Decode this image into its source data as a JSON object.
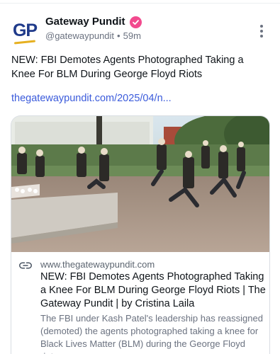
{
  "author": {
    "avatar_text": "GP",
    "name": "Gateway Pundit",
    "handle": "@gatewaypundit",
    "separator": "•",
    "time": "59m"
  },
  "post": {
    "text": "NEW: FBI Demotes Agents Photographed Taking a Knee For BLM During George Floyd Riots",
    "link_text": "thegatewaypundit.com/2025/04/n..."
  },
  "card": {
    "image_alt": "Agents kneeling on a plaza",
    "domain": "www.thegatewaypundit.com",
    "title": "NEW: FBI Demotes Agents Photographed Taking a Knee For BLM During George Floyd Riots | The Gateway Pundit | by Cristina Laila",
    "description": "The FBI under Kash Patel's leadership has reassigned (demoted) the agents photographed taking a knee for Black Lives Matter (BLM) during the George Floyd riots."
  },
  "icons": {
    "verified": "verified-badge-icon",
    "more": "more-vertical-icon",
    "link": "link-icon"
  },
  "colors": {
    "link": "#3b5bdb",
    "verified": "#f24a8e",
    "text": "#0f1419",
    "muted": "#6b7280"
  }
}
